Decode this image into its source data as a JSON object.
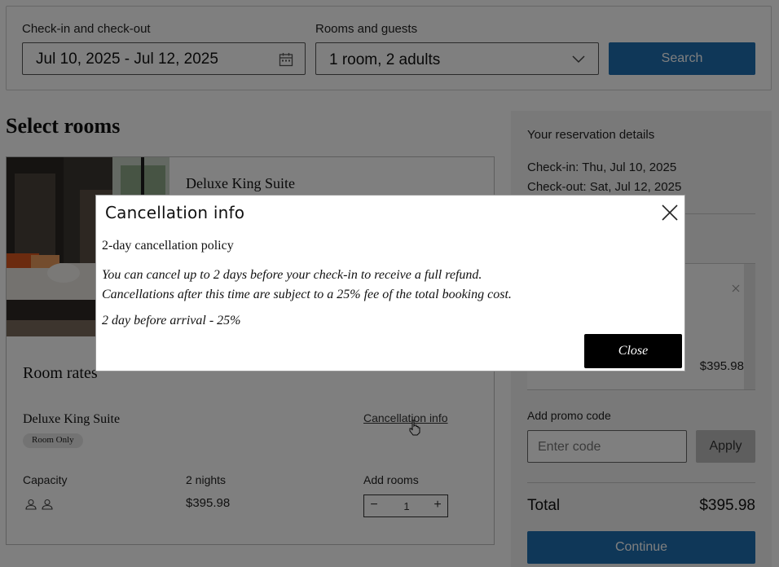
{
  "search": {
    "dates_label": "Check-in and check-out",
    "dates_value": "Jul 10, 2025 - Jul 12, 2025",
    "rooms_label": "Rooms and guests",
    "rooms_value": "1 room, 2 adults",
    "search_button": "Search"
  },
  "main": {
    "title": "Select rooms",
    "room": {
      "name": "Deluxe King Suite"
    },
    "rates": {
      "title": "Room rates",
      "room_name": "Deluxe King Suite",
      "badge": "Room Only",
      "cancellation_link": "Cancellation info",
      "capacity_label": "Capacity",
      "nights_label": "2 nights",
      "price": "$395.98",
      "add_rooms_label": "Add rooms",
      "quantity": "1",
      "minus": "−",
      "plus": "+"
    }
  },
  "reservation": {
    "title": "Your reservation details",
    "checkin": "Check-in: Thu, Jul 10, 2025",
    "checkout": "Check-out: Sat, Jul 12, 2025",
    "item_price": "$395.98",
    "promo_label": "Add promo code",
    "promo_placeholder": "Enter code",
    "apply_button": "Apply",
    "total_label": "Total",
    "total_value": "$395.98",
    "continue_button": "Continue"
  },
  "modal": {
    "title": "Cancellation info",
    "policy_name": "2-day cancellation policy",
    "description_line1": "You can cancel up to 2 days before your check-in to receive a full refund.",
    "description_line2": "Cancellations after this time are subject to a 25% fee of the total booking cost.",
    "rule": "2 day before arrival - 25%",
    "close_button": "Close"
  },
  "colors": {
    "primary": "#1e6fb0",
    "overlay": "#000000",
    "modal_button": "#000000"
  }
}
